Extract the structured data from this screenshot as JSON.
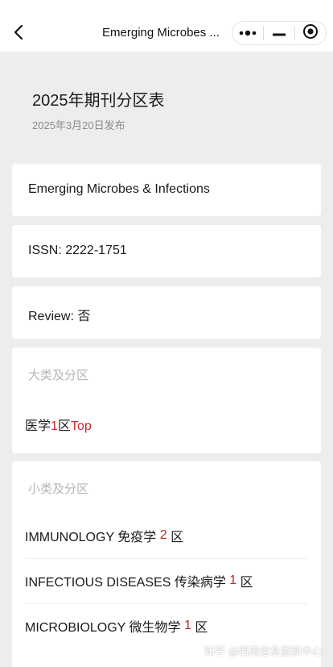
{
  "nav": {
    "title": "Emerging Microbes ..."
  },
  "header": {
    "title": "2025年期刊分区表",
    "subtitle": "2025年3月20日发布"
  },
  "journal": {
    "name": "Emerging Microbes & Infections",
    "issn": "ISSN: 2222-1751",
    "review": "Review: 否"
  },
  "major": {
    "label": "大类及分区",
    "prefix": "医学",
    "zone": "1",
    "zone_suffix": "区",
    "top": "Top"
  },
  "minor": {
    "label": "小类及分区",
    "rows": [
      {
        "name": "IMMUNOLOGY 免疫学",
        "zone": "2",
        "suffix": "区"
      },
      {
        "name": "INFECTIOUS DISEASES 传染病学",
        "zone": "1",
        "suffix": "区"
      },
      {
        "name": "MICROBIOLOGY 微生物学",
        "zone": "1",
        "suffix": "区"
      }
    ]
  },
  "watermark": "知乎 @西南信息童新中心",
  "colors": {
    "accent_red": "#c7252b",
    "background": "#ededed"
  },
  "icons": {
    "back": "chevron-left-icon",
    "more": "more-dots-icon",
    "minimize": "minimize-icon",
    "close": "target-close-icon"
  }
}
